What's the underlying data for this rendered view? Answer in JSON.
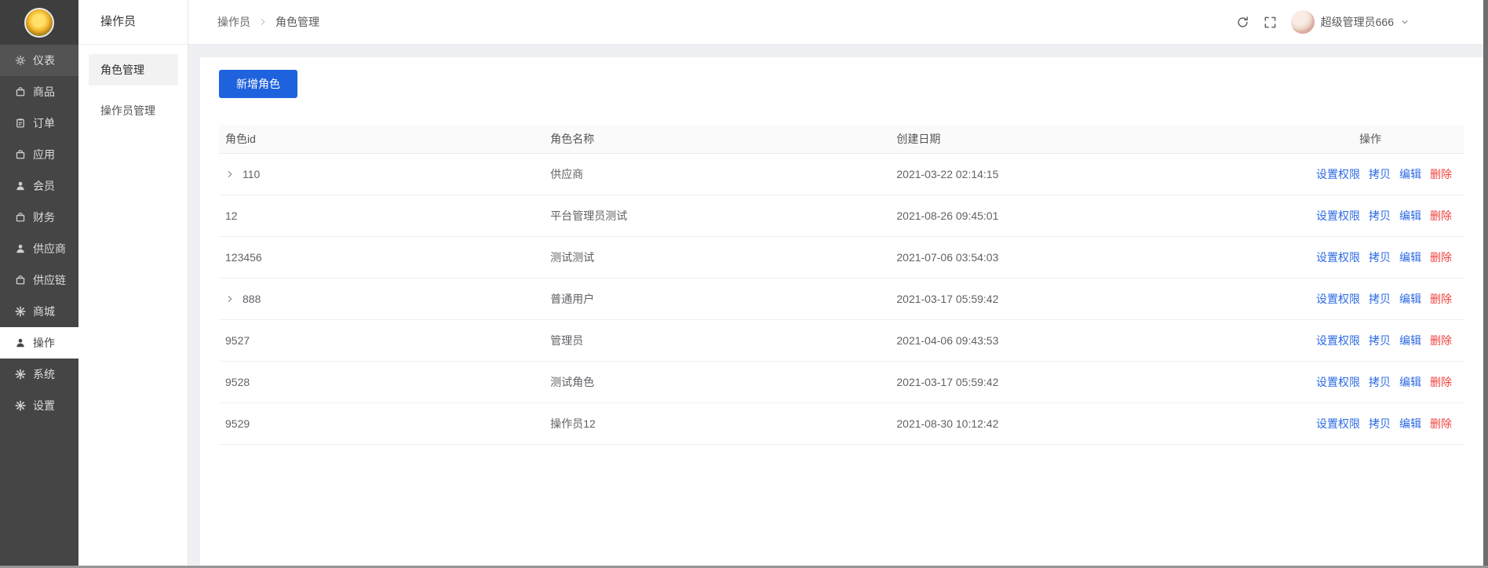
{
  "colors": {
    "accent": "#1f62de",
    "link": "#2c6ae4",
    "danger": "#f0413d",
    "sidebar_bg": "#454545",
    "content_bg": "#eef0f4"
  },
  "sidebar": {
    "items": [
      {
        "key": "dashboard",
        "label": "仪表",
        "icon": "gear",
        "state": "hovered"
      },
      {
        "key": "goods",
        "label": "商品",
        "icon": "bag",
        "state": ""
      },
      {
        "key": "orders",
        "label": "订单",
        "icon": "clipboard",
        "state": ""
      },
      {
        "key": "apps",
        "label": "应用",
        "icon": "bag",
        "state": ""
      },
      {
        "key": "members",
        "label": "会员",
        "icon": "person",
        "state": ""
      },
      {
        "key": "finance",
        "label": "财务",
        "icon": "bag",
        "state": ""
      },
      {
        "key": "supplier",
        "label": "供应商",
        "icon": "person",
        "state": ""
      },
      {
        "key": "supply-chain",
        "label": "供应链",
        "icon": "bag",
        "state": ""
      },
      {
        "key": "mall",
        "label": "商城",
        "icon": "gear-solid",
        "state": ""
      },
      {
        "key": "operations",
        "label": "操作",
        "icon": "person",
        "state": "active"
      },
      {
        "key": "system",
        "label": "系统",
        "icon": "gear-solid",
        "state": ""
      },
      {
        "key": "settings",
        "label": "设置",
        "icon": "gear-solid",
        "state": ""
      }
    ]
  },
  "submenu": {
    "title": "操作员",
    "items": [
      {
        "key": "role-management",
        "label": "角色管理",
        "active": true
      },
      {
        "key": "operator-management",
        "label": "操作员管理",
        "active": false
      }
    ]
  },
  "topbar": {
    "breadcrumb": [
      "操作员",
      "角色管理"
    ],
    "username": "超级管理员666"
  },
  "content": {
    "add_button": "新增角色"
  },
  "table": {
    "headers": [
      "角色id",
      "角色名称",
      "创建日期",
      "操作"
    ],
    "action_labels": [
      "设置权限",
      "拷贝",
      "编辑",
      "删除"
    ],
    "rows": [
      {
        "id": "110",
        "expandable": true,
        "name": "供应商",
        "date": "2021-03-22 02:14:15"
      },
      {
        "id": "12",
        "expandable": false,
        "name": "平台管理员测试",
        "date": "2021-08-26 09:45:01"
      },
      {
        "id": "123456",
        "expandable": false,
        "name": "测试测试",
        "date": "2021-07-06 03:54:03"
      },
      {
        "id": "888",
        "expandable": true,
        "name": "普通用户",
        "date": "2021-03-17 05:59:42"
      },
      {
        "id": "9527",
        "expandable": false,
        "name": "管理员",
        "date": "2021-04-06 09:43:53"
      },
      {
        "id": "9528",
        "expandable": false,
        "name": "测试角色",
        "date": "2021-03-17 05:59:42"
      },
      {
        "id": "9529",
        "expandable": false,
        "name": "操作员12",
        "date": "2021-08-30 10:12:42"
      }
    ]
  }
}
